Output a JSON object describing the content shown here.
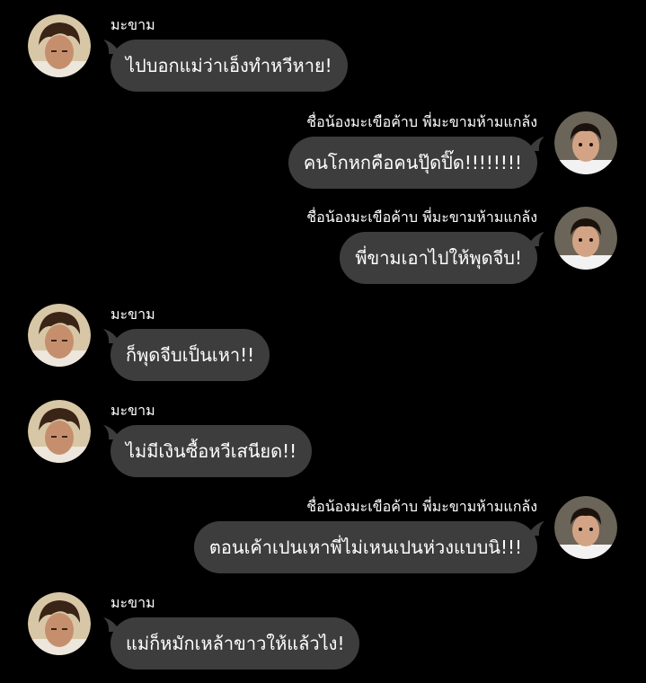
{
  "colors": {
    "background": "#000000",
    "bubble": "#3d3d3d",
    "text": "#ffffff"
  },
  "senders": {
    "left": "มะขาม",
    "right": "ชื่อน้องมะเขือค้าบ พี่มะขามห้ามแกล้ง"
  },
  "messages": [
    {
      "side": "left",
      "name": "มะขาม",
      "text": "ไปบอกแม่ว่าเอ็งทำหวีหาย!",
      "avatar": "older-boy-avatar"
    },
    {
      "side": "right",
      "name": "ชื่อน้องมะเขือค้าบ พี่มะขามห้ามแกล้ง",
      "text": "คนโกหกคือคนปุ๊ดปิ๊ด!!!!!!!!",
      "avatar": "little-boy-avatar"
    },
    {
      "side": "right",
      "name": "ชื่อน้องมะเขือค้าบ พี่มะขามห้ามแกล้ง",
      "text": "พี่ขามเอาไปให้พุดจีบ!",
      "avatar": "little-boy-avatar"
    },
    {
      "side": "left",
      "name": "มะขาม",
      "text": "ก็พุดจีบเป็นเหา!!",
      "avatar": "older-boy-avatar"
    },
    {
      "side": "left",
      "name": "มะขาม",
      "text": "ไม่มีเงินซื้อหวีเสนียด!!",
      "avatar": "older-boy-avatar"
    },
    {
      "side": "right",
      "name": "ชื่อน้องมะเขือค้าบ พี่มะขามห้ามแกล้ง",
      "text": "ตอนเค้าเปนเหาพี่ไม่เหนเปนห่วงแบบนิ!!!",
      "avatar": "little-boy-avatar"
    },
    {
      "side": "left",
      "name": "มะขาม",
      "text": "แม่ก็หมักเหล้าขาวให้แล้วไง!",
      "avatar": "older-boy-avatar"
    }
  ]
}
